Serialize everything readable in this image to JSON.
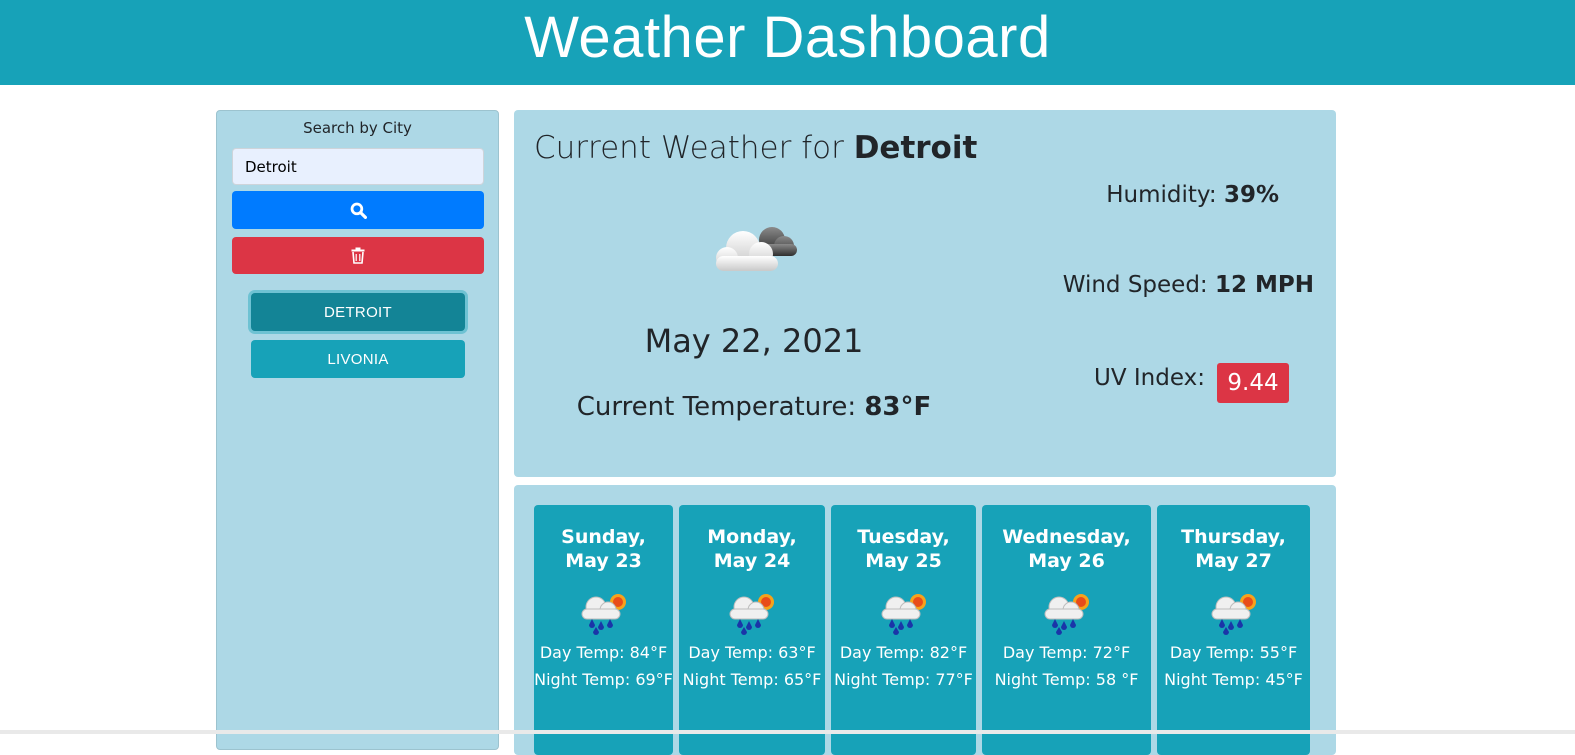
{
  "header": {
    "title": "Weather Dashboard"
  },
  "sidebar": {
    "title": "Search by City",
    "search_value": "Detroit",
    "search_icon": "search-icon",
    "clear_icon": "trash-icon",
    "history": [
      "DETROIT",
      "LIVONIA"
    ]
  },
  "current": {
    "title_prefix": "Current Weather for ",
    "city": "Detroit",
    "icon": "cloudy-icon",
    "date": "May 22, 2021",
    "temp_label": "Current Temperature: ",
    "temp_value": "83°F",
    "humidity_label": "Humidity: ",
    "humidity_value": "39%",
    "wind_label": "Wind Speed: ",
    "wind_value": "12 MPH",
    "uv_label": "UV Index:",
    "uv_value": "9.44"
  },
  "forecast": [
    {
      "day": "Sunday,",
      "date": "May 23",
      "icon": "rain-sun-icon",
      "day_temp": "Day Temp: 84°F",
      "night_temp": "Night Temp: 69°F"
    },
    {
      "day": "Monday,",
      "date": "May 24",
      "icon": "rain-sun-icon",
      "day_temp": "Day Temp: 63°F",
      "night_temp": "Night Temp: 65°F"
    },
    {
      "day": "Tuesday,",
      "date": "May 25",
      "icon": "rain-sun-icon",
      "day_temp": "Day Temp: 82°F",
      "night_temp": "Night Temp: 77°F"
    },
    {
      "day": "Wednesday,",
      "date": "May 26",
      "icon": "rain-sun-icon",
      "day_temp": "Day Temp: 72°F",
      "night_temp": "Night Temp: 58 °F"
    },
    {
      "day": "Thursday,",
      "date": "May 27",
      "icon": "rain-sun-icon",
      "day_temp": "Day Temp: 55°F",
      "night_temp": "Night Temp: 45°F"
    }
  ],
  "colors": {
    "header": "#17a2b8",
    "panel": "#add8e6",
    "search_button": "#007bff",
    "clear_button": "#dc3545",
    "uv_badge": "#dc3545"
  }
}
